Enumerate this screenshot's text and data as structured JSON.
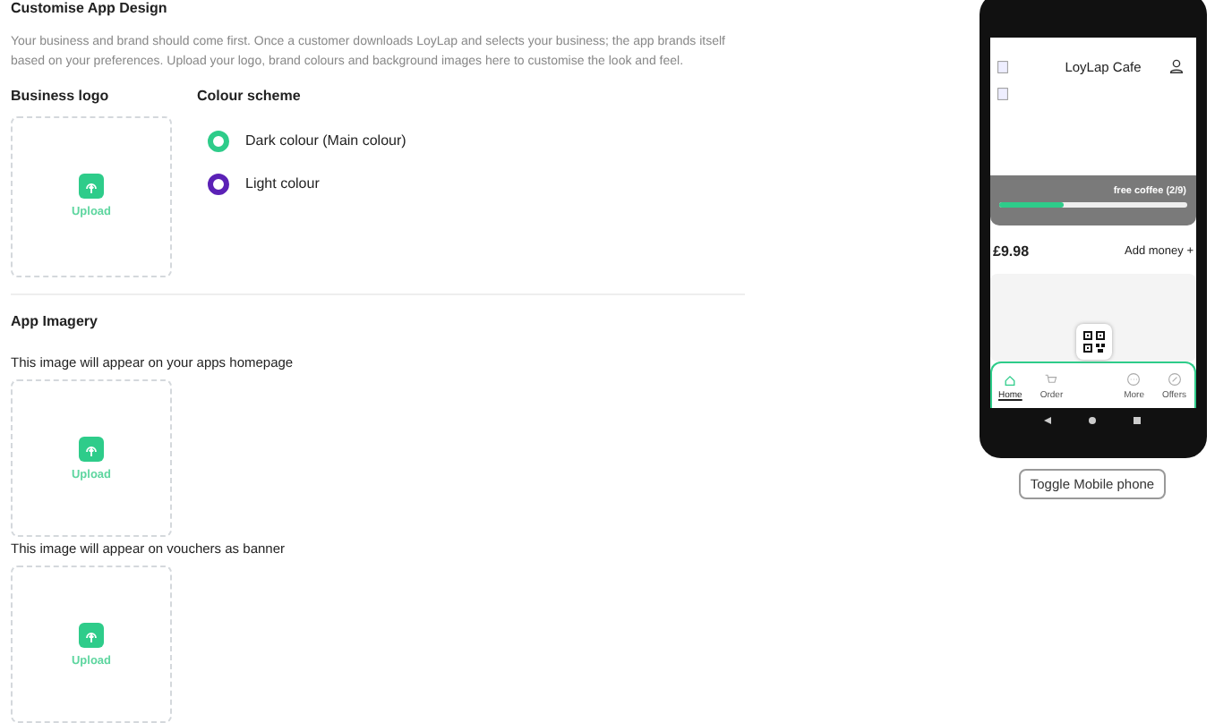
{
  "title": "Customise App Design",
  "description": "Your business and brand should come first. Once a customer downloads LoyLap and selects your business; the app brands itself based on your preferences. Upload your logo, brand colours and background images here to customise the look and feel.",
  "business_logo": {
    "heading": "Business logo",
    "upload_label": "Upload"
  },
  "colour_scheme": {
    "heading": "Colour scheme",
    "options": [
      {
        "label": "Dark colour (Main colour)",
        "color": "#2ecc8a"
      },
      {
        "label": "Light colour",
        "color": "#5b21b6"
      }
    ]
  },
  "app_imagery": {
    "heading": "App Imagery",
    "slots": [
      {
        "caption": "This image will appear on your apps homepage",
        "upload_label": "Upload"
      },
      {
        "caption": "This image will appear on vouchers as banner",
        "upload_label": "Upload"
      }
    ]
  },
  "phone_preview": {
    "cafe_name": "LoyLap Cafe",
    "reward": {
      "label": "free coffee (2/9)",
      "level": 0.35
    },
    "balance": "£9.98",
    "add_money": "Add money +",
    "tabs": [
      {
        "label": "Home",
        "selected": true,
        "kind": "home"
      },
      {
        "label": "Order",
        "selected": false,
        "kind": "order"
      },
      {
        "label": "More",
        "selected": false,
        "kind": "more"
      },
      {
        "label": "Offers",
        "selected": false,
        "kind": "offers"
      }
    ]
  },
  "toggle_button": "Toggle Mobile phone"
}
